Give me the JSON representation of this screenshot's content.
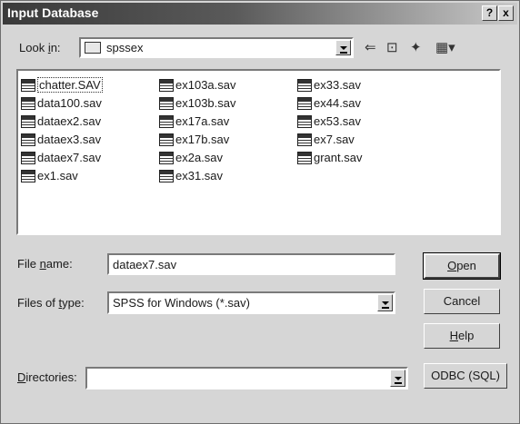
{
  "window": {
    "title": "Input Database",
    "help_button": "?",
    "close_button": "x"
  },
  "look_in": {
    "label_pre": "Look ",
    "label_u": "i",
    "label_post": "n:",
    "value": "spssex"
  },
  "toolbar": {
    "back": "⇐",
    "up_folder": "⊡",
    "new_folder": "✦",
    "view_menu": "▦▾"
  },
  "files": {
    "col1": [
      "chatter.SAV",
      "data100.sav",
      "dataex2.sav",
      "dataex3.sav",
      "dataex7.sav",
      "ex1.sav"
    ],
    "col2": [
      "ex103a.sav",
      "ex103b.sav",
      "ex17a.sav",
      "ex17b.sav",
      "ex2a.sav",
      "ex31.sav"
    ],
    "col3": [
      "ex33.sav",
      "ex44.sav",
      "ex53.sav",
      "ex7.sav",
      "grant.sav"
    ]
  },
  "file_name": {
    "label_pre": "File ",
    "label_u": "n",
    "label_post": "ame:",
    "value": "dataex7.sav"
  },
  "files_of_type": {
    "label_pre": "Files of ",
    "label_u": "t",
    "label_post": "ype:",
    "value": "SPSS for Windows (*.sav)"
  },
  "directories": {
    "label_u": "D",
    "label_post": "irectories:",
    "value": ""
  },
  "buttons": {
    "open_u": "O",
    "open_post": "pen",
    "cancel": "Cancel",
    "help_u": "H",
    "help_post": "elp",
    "odbc": "ODBC (SQL)"
  }
}
